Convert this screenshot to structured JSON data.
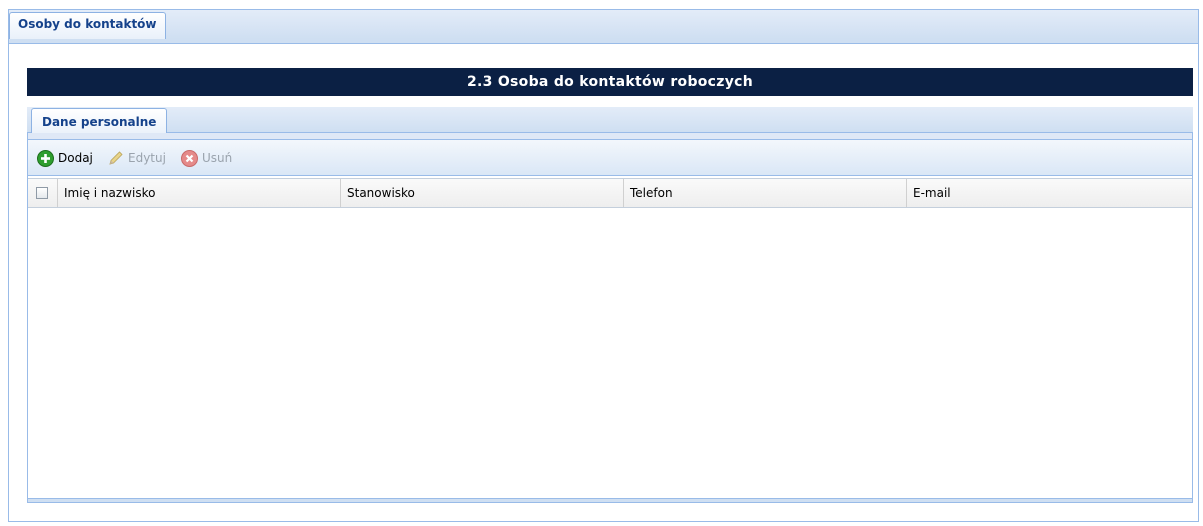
{
  "outer_tab": {
    "label": "Osoby do kontaktów"
  },
  "section": {
    "title": "2.3 Osoba do kontaktów roboczych"
  },
  "inner_tab": {
    "label": "Dane personalne"
  },
  "toolbar": {
    "add_label": "Dodaj",
    "edit_label": "Edytuj",
    "delete_label": "Usuń",
    "add_icon": "plus-circle-icon",
    "edit_icon": "pencil-icon",
    "delete_icon": "x-circle-icon"
  },
  "grid": {
    "columns": [
      "Imię i nazwisko",
      "Stanowisko",
      "Telefon",
      "E-mail"
    ],
    "rows": []
  },
  "colors": {
    "title_bg": "#0b2044",
    "tab_text": "#15428b",
    "border": "#99bbe8",
    "add_icon": "#2e9e2e",
    "delete_icon": "#e58a8a"
  }
}
